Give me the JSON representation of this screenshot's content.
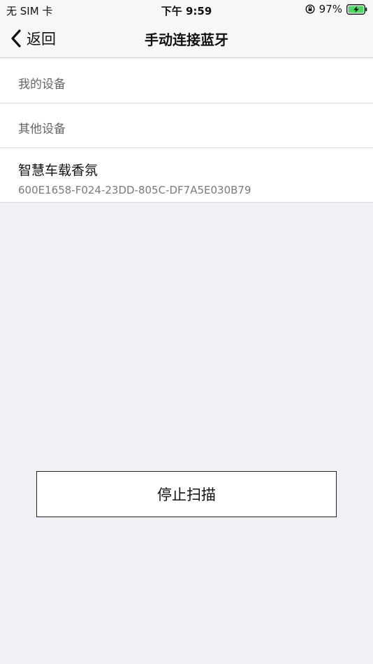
{
  "status_bar": {
    "carrier": "无 SIM 卡",
    "time": "下午 9:59",
    "battery": "97%",
    "icons": [
      "orientation-lock-icon",
      "battery-charging-icon"
    ]
  },
  "nav": {
    "back_label": "返回",
    "title": "手动连接蓝牙"
  },
  "sections": {
    "my_devices": "我的设备",
    "other_devices": "其他设备"
  },
  "devices": [
    {
      "name": "智慧车载香氛",
      "id": "600E1658-F024-23DD-805C-DF7A5E030B79"
    }
  ],
  "actions": {
    "stop_scan": "停止扫描"
  },
  "colors": {
    "background": "#f1f0f5",
    "battery_fill": "#4cd964"
  }
}
